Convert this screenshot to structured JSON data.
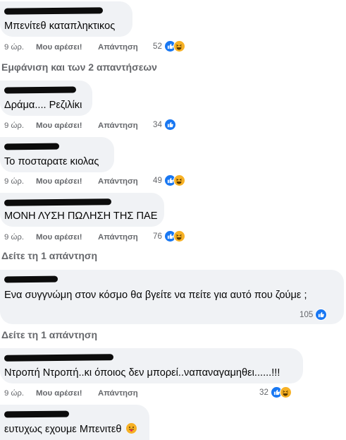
{
  "comments": [
    {
      "text": "Μπενίτεθ καταπληκτικος",
      "time": "9 ώρ.",
      "like": "Μου αρέσει!",
      "reply": "Απάντηση",
      "count": "52",
      "reactions": [
        "like-icon",
        "haha-icon"
      ]
    },
    {
      "text": "Δράμα.... Ρεζιλίκι",
      "time": "9 ώρ.",
      "like": "Μου αρέσει!",
      "reply": "Απάντηση",
      "count": "34",
      "reactions": [
        "like-icon"
      ]
    },
    {
      "text": "Το ποσταρατε κιολας",
      "time": "9 ώρ.",
      "like": "Μου αρέσει!",
      "reply": "Απάντηση",
      "count": "49",
      "reactions": [
        "like-icon",
        "haha-icon"
      ]
    },
    {
      "text": "ΜΟΝΗ ΛΥΣΗ ΠΩΛΗΣΗ ΤΗΣ ΠΑΕ",
      "time": "9 ώρ.",
      "like": "Μου αρέσει!",
      "reply": "Απάντηση",
      "count": "76",
      "reactions": [
        "like-icon",
        "haha-icon"
      ]
    },
    {
      "text": "Ενα συγγνώμη στον κόσμο θα βγείτε να πείτε για αυτό που ζούμε ;",
      "count": "105",
      "reactions": [
        "like-icon"
      ]
    },
    {
      "text": "Ντροπή Ντροπή..κι όποιος δεν μπορεί..ναπαναγαμηθει......!!!",
      "time": "9 ώρ.",
      "like": "Μου αρέσει!",
      "reply": "Απάντηση",
      "count": "32",
      "reactions": [
        "like-icon",
        "haha-icon"
      ]
    },
    {
      "text": "ευτυχως εχουμε Μπενιτεθ",
      "emoji": "tongue-out-emoji"
    }
  ],
  "links": {
    "show_replies": "Εμφάνιση και των 2 απαντήσεων",
    "see_reply_1": "Δείτε τη 1 απάντηση",
    "see_reply_2": "Δείτε τη 1 απάντηση"
  },
  "colors": {
    "bubble": "#f0f2f5",
    "meta": "#65676b",
    "like_blue": "#1877f2",
    "haha_yellow": "#f7b125"
  }
}
